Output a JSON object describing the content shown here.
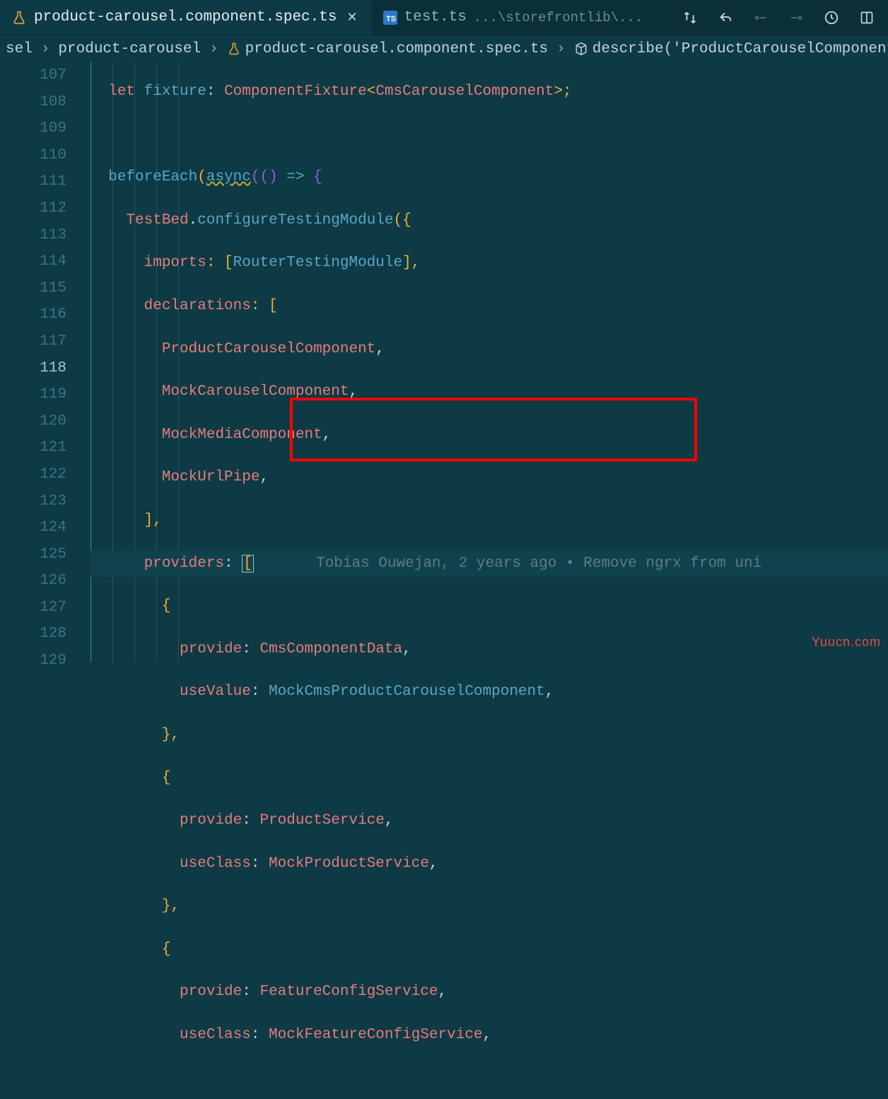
{
  "tabs": {
    "active": {
      "label": "product-carousel.component.spec.ts"
    },
    "second": {
      "label": "test.ts",
      "hint": "...\\storefrontlib\\..."
    }
  },
  "toolbar_icons": [
    "compare-changes",
    "go-back",
    "go-forward",
    "run",
    "more",
    "split-editor"
  ],
  "breadcrumbs": {
    "a": "sel",
    "b": "product-carousel",
    "c": "product-carousel.component.spec.ts",
    "d": "describe('ProductCarouselComponent'"
  },
  "gutter": {
    "start": 107,
    "count": 23,
    "current": 118
  },
  "code": {
    "l107": {
      "p0": "let ",
      "p1": "fixture",
      "p2": ": ",
      "p3": "ComponentFixture",
      "p4": "<",
      "p5": "CmsCarouselComponent",
      "p6": ">;"
    },
    "l109_a": "beforeEach",
    "l109_b": "async",
    "l109_c": "(()",
    "l109_d": "=>",
    "l109_e": "{",
    "l110_a": "TestBed",
    "l110_b": ".",
    "l110_c": "configureTestingModule",
    "l110_d": "({",
    "l111_a": "imports",
    "l111_b": ": [",
    "l111_c": "RouterTestingModule",
    "l111_d": "],",
    "l112_a": "declarations",
    "l112_b": ": [",
    "l113": "ProductCarouselComponent",
    "l114": "MockCarouselComponent",
    "l115": "MockMediaComponent",
    "l116": "MockUrlPipe",
    "l117": "],",
    "l118_a": "providers",
    "l118_b": ": ",
    "l118_c": "[",
    "blame": "Tobias Ouwejan, 2 years ago • Remove ngrx from uni",
    "l119": "{",
    "l120_a": "provide",
    "l120_b": ": ",
    "l120_c": "CmsComponentData",
    "l120_d": ",",
    "l121_a": "useValue",
    "l121_b": ": ",
    "l121_c": "MockCmsProductCarouselComponent",
    "l121_d": ",",
    "l122": "},",
    "l123": "{",
    "l124_a": "provide",
    "l124_b": ": ",
    "l124_c": "ProductService",
    "l124_d": ",",
    "l125_a": "useClass",
    "l125_b": ": ",
    "l125_c": "MockProductService",
    "l125_d": ",",
    "l126": "},",
    "l127": "{",
    "l128_a": "provide",
    "l128_b": ": ",
    "l128_c": "FeatureConfigService",
    "l128_d": ",",
    "l129_a": "useClass",
    "l129_b": ": ",
    "l129_c": "MockFeatureConfigService",
    "l129_d": ","
  },
  "watermark": "Yuucn.com",
  "highlight_box": {
    "l120": true,
    "l121": true
  }
}
